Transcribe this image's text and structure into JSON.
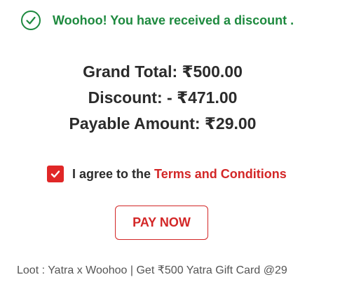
{
  "banner": {
    "icon": "check-circle-icon",
    "message": "Woohoo! You have received a discount ."
  },
  "summary": {
    "grand_total": "Grand Total: ₹500.00",
    "discount": "Discount: - ₹471.00",
    "payable_amount": "Payable Amount: ₹29.00"
  },
  "agreement": {
    "checked": true,
    "prefix": "I agree to the ",
    "link_text": "Terms and Conditions"
  },
  "pay_button": {
    "label": "PAY NOW"
  },
  "footer": {
    "text": "Loot : Yatra x Woohoo | Get ₹500 Yatra Gift Card @29"
  },
  "colors": {
    "success_green": "#1e8a3f",
    "accent_red": "#d32727",
    "checkbox_red": "#e02727",
    "text_dark": "#2b2b2b",
    "text_muted": "#555555"
  }
}
